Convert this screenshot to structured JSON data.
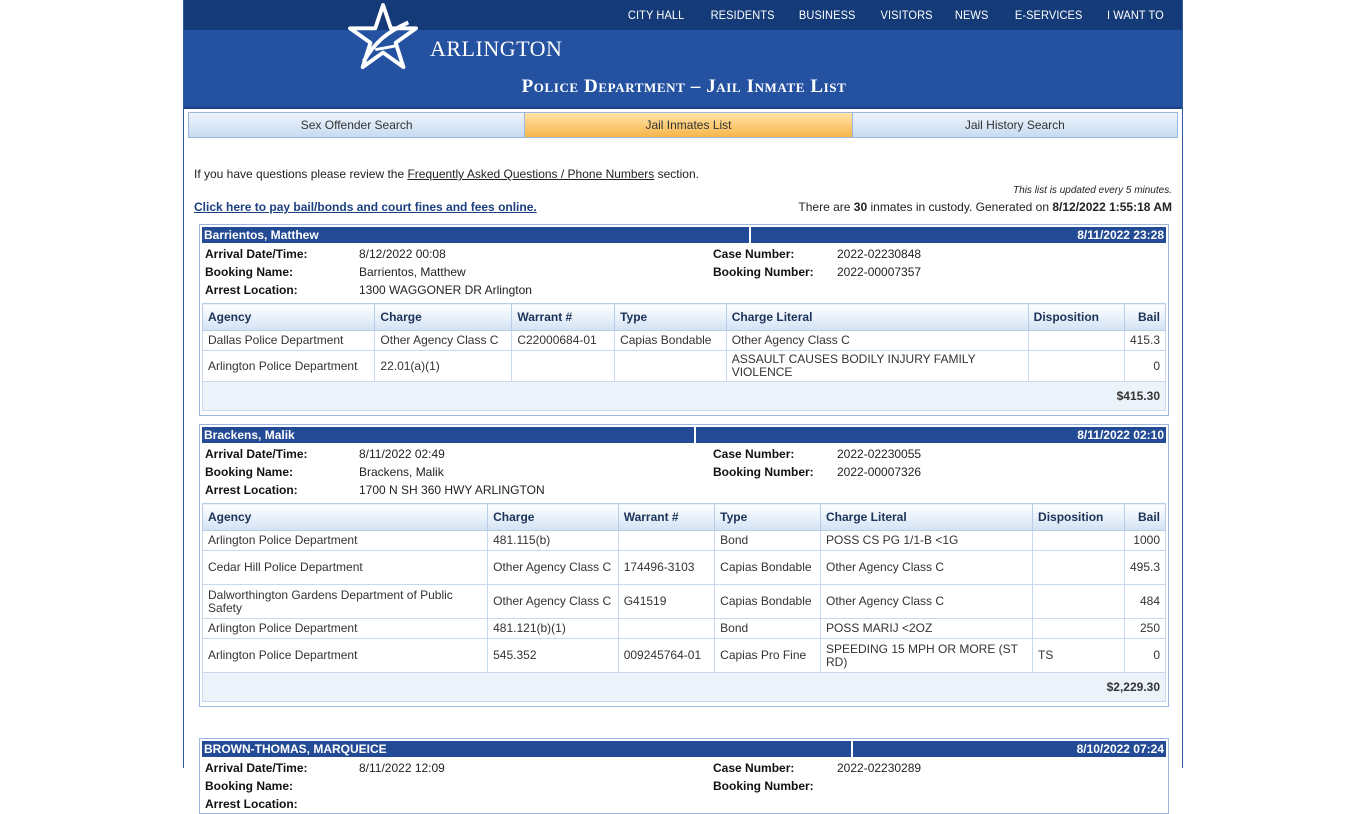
{
  "header": {
    "nav": [
      "CITY HALL",
      "RESIDENTS",
      "BUSINESS",
      "VISITORS",
      "NEWS",
      "E-SERVICES",
      "I WANT TO"
    ],
    "logo_text": "ARLINGTON",
    "page_title": "Police Department – Jail Inmate List"
  },
  "tabs": [
    {
      "label": "Sex Offender Search",
      "active": false
    },
    {
      "label": "Jail Inmates List",
      "active": true
    },
    {
      "label": "Jail History Search",
      "active": false
    }
  ],
  "intro": {
    "before": "If you have questions please review the ",
    "link": "Frequently Asked Questions / Phone Numbers",
    "after": " section."
  },
  "update_note": "This list is updated every 5 minutes.",
  "pay_link": "Click here to pay bail/bonds and court fines and fees online.",
  "custody": {
    "prefix": "There are ",
    "count": "30",
    "middle": " inmates in custody. Generated on ",
    "generated": "8/12/2022 1:55:18 AM"
  },
  "labels": {
    "arrival": "Arrival Date/Time:",
    "booking_name": "Booking Name:",
    "arrest_location": "Arrest Location:",
    "case_number": "Case Number:",
    "booking_number": "Booking Number:"
  },
  "columns": [
    "Agency",
    "Charge",
    "Warrant #",
    "Type",
    "Charge Literal",
    "Disposition",
    "Bail"
  ],
  "records": [
    {
      "name": "Barrientos, Matthew",
      "date": "8/11/2022 23:28",
      "arrival": "8/12/2022 00:08",
      "booking_name": "Barrientos, Matthew",
      "arrest_location": "1300 WAGGONER DR Arlington",
      "case_number": "2022-02230848",
      "booking_number": "2022-00007357",
      "charges": [
        [
          "Dallas Police Department",
          "Other Agency Class C",
          "C22000684-01",
          "Capias Bondable",
          "Other Agency Class C",
          "",
          "415.3"
        ],
        [
          "Arlington Police Department",
          "22.01(a)(1)",
          "",
          "",
          "ASSAULT CAUSES BODILY INJURY FAMILY VIOLENCE",
          "",
          "0"
        ]
      ],
      "total": "$415.30"
    },
    {
      "name": "Brackens, Malik",
      "date": "8/11/2022 02:10",
      "arrival": "8/11/2022 02:49",
      "booking_name": "Brackens, Malik",
      "arrest_location": "1700 N SH 360 HWY ARLINGTON",
      "case_number": "2022-02230055",
      "booking_number": "2022-00007326",
      "charges": [
        [
          "Arlington Police Department",
          "481.115(b)",
          "",
          "Bond",
          "POSS CS PG 1/1-B <1G",
          "",
          "1000"
        ],
        [
          "Cedar Hill Police Department",
          "Other Agency Class C",
          "174496-3103",
          "Capias Bondable",
          "Other Agency Class C",
          "",
          "495.3"
        ],
        [
          "Dalworthington Gardens Department of Public Safety",
          "Other Agency Class C",
          "G41519",
          "Capias Bondable",
          "Other Agency Class C",
          "",
          "484"
        ],
        [
          "Arlington Police Department",
          "481.121(b)(1)",
          "",
          "Bond",
          "POSS MARIJ <2OZ",
          "",
          "250"
        ],
        [
          "Arlington Police Department",
          "545.352",
          "009245764-01",
          "Capias Pro Fine",
          "SPEEDING 15 MPH OR MORE (ST RD)",
          "TS",
          "0"
        ]
      ],
      "total": "$2,229.30"
    },
    {
      "name": "BROWN-THOMAS, MARQUEICE",
      "date": "8/10/2022 07:24",
      "arrival": "8/11/2022 12:09",
      "booking_name": "",
      "arrest_location": "",
      "case_number": "2022-02230289",
      "booking_number": "",
      "charges": [],
      "total": ""
    }
  ]
}
